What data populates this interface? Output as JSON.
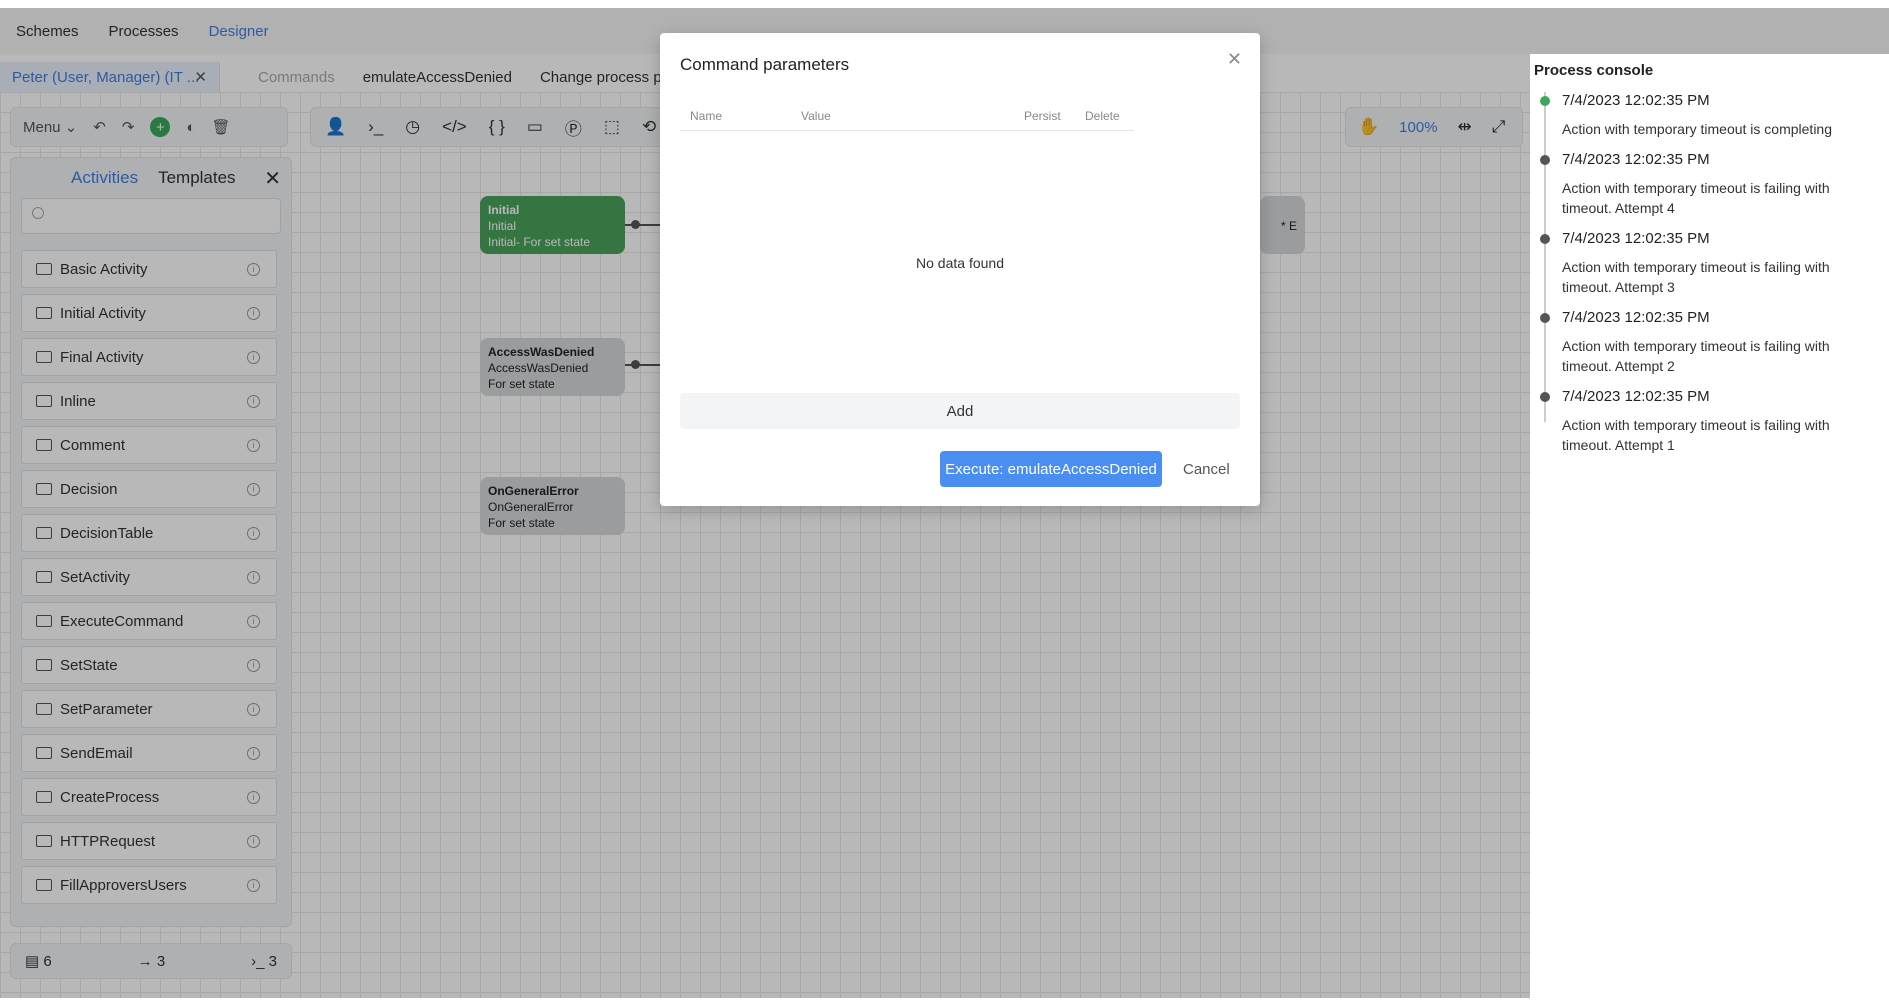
{
  "topnav": {
    "items": [
      "Schemes",
      "Processes",
      "Designer"
    ],
    "active": "Designer"
  },
  "user_chip": {
    "label": "Peter (User, Manager) (IT ..."
  },
  "commands_bar": {
    "commands_label": "Commands",
    "command": "emulateAccessDenied",
    "change_params": "Change process par"
  },
  "toolbar_left": {
    "menu_label": "Menu"
  },
  "toolbar_right": {
    "zoom": "100%"
  },
  "side_panel": {
    "tabs": [
      "Activities",
      "Templates"
    ],
    "search": {
      "placeholder": "",
      "value": ""
    },
    "activities": [
      "Basic Activity",
      "Initial Activity",
      "Final Activity",
      "Inline",
      "Comment",
      "Decision",
      "DecisionTable",
      "SetActivity",
      "ExecuteCommand",
      "SetState",
      "SetParameter",
      "SendEmail",
      "CreateProcess",
      "HTTPRequest",
      "FillApproversUsers"
    ]
  },
  "stats": {
    "activities": "6",
    "transitions": "3",
    "commands": "3"
  },
  "nodes": {
    "initial": {
      "title": "Initial",
      "line2": "Initial",
      "line3": "Initial- For set state"
    },
    "access_denied": {
      "title": "AccessWasDenied",
      "line2": "AccessWasDenied",
      "line3": "For set state"
    },
    "general_error": {
      "title": "OnGeneralError",
      "line2": "OnGeneralError",
      "line3": "For set state"
    },
    "partial_right": "* E"
  },
  "console": {
    "title": "Process console",
    "entries": [
      {
        "time": "7/4/2023 12:02:35 PM",
        "msg": "Action with temporary timeout is completing",
        "status": "green"
      },
      {
        "time": "7/4/2023 12:02:35 PM",
        "msg": "Action with temporary timeout is failing with timeout. Attempt 4",
        "status": "gray"
      },
      {
        "time": "7/4/2023 12:02:35 PM",
        "msg": "Action with temporary timeout is failing with timeout. Attempt 3",
        "status": "gray"
      },
      {
        "time": "7/4/2023 12:02:35 PM",
        "msg": "Action with temporary timeout is failing with timeout. Attempt 2",
        "status": "gray"
      },
      {
        "time": "7/4/2023 12:02:35 PM",
        "msg": "Action with temporary timeout is failing with timeout. Attempt 1",
        "status": "gray"
      }
    ]
  },
  "modal": {
    "title": "Command parameters",
    "columns": [
      "Name",
      "Value",
      "Persist",
      "Delete"
    ],
    "empty_text": "No data found",
    "add_label": "Add",
    "execute_label": "Execute: emulateAccessDenied",
    "cancel_label": "Cancel"
  }
}
